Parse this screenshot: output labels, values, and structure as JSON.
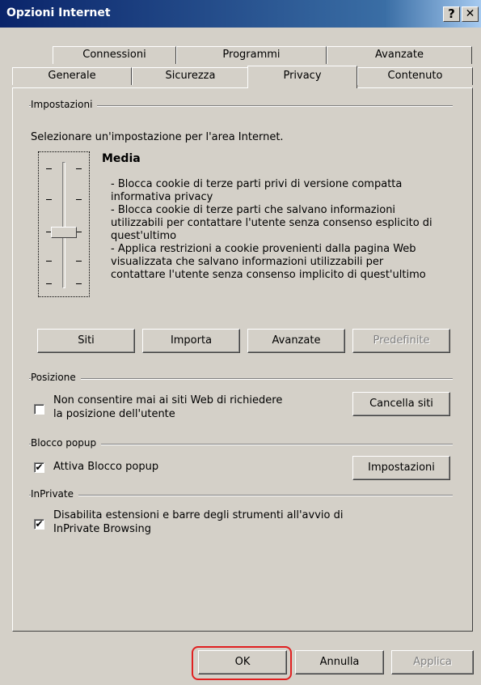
{
  "window": {
    "title": "Opzioni Internet",
    "help_glyph": "?",
    "close_glyph": "✕"
  },
  "tabs_back": [
    "Connessioni",
    "Programmi",
    "Avanzate"
  ],
  "tabs_front": [
    "Generale",
    "Sicurezza",
    "Privacy",
    "Contenuto"
  ],
  "active_tab": "Privacy",
  "settings": {
    "group": "Impostazioni",
    "instruction": "Selezionare un'impostazione per l'area Internet.",
    "level": "Media",
    "description": [
      "- Blocca cookie di terze parti privi di versione compatta",
      "informativa privacy",
      "- Blocca cookie di terze parti che salvano informazioni",
      "utilizzabili per contattare l'utente senza consenso esplicito di",
      "quest'ultimo",
      "- Applica restrizioni a cookie provenienti dalla pagina Web",
      "visualizzata che salvano informazioni utilizzabili per",
      "contattare l'utente senza consenso implicito di quest'ultimo"
    ],
    "buttons": [
      "Siti",
      "Importa",
      "Avanzate",
      "Predefinite"
    ]
  },
  "location": {
    "group": "Posizione",
    "checkbox_label_1": "Non consentire mai ai siti Web di richiedere",
    "checkbox_label_2": "la posizione dell'utente",
    "checked": false,
    "button": "Cancella siti"
  },
  "popup": {
    "group": "Blocco popup",
    "checkbox_label": "Attiva Blocco popup",
    "checked": true,
    "button": "Impostazioni"
  },
  "inprivate": {
    "group": "InPrivate",
    "checkbox_label_1": "Disabilita estensioni e barre degli strumenti all'avvio di",
    "checkbox_label_2": "InPrivate Browsing",
    "checked": true
  },
  "footer": {
    "ok": "OK",
    "cancel": "Annulla",
    "apply": "Applica"
  },
  "colors": {
    "titlebar": "#0a246a",
    "highlight_ring": "#e02020",
    "face": "#d4d0c8"
  }
}
